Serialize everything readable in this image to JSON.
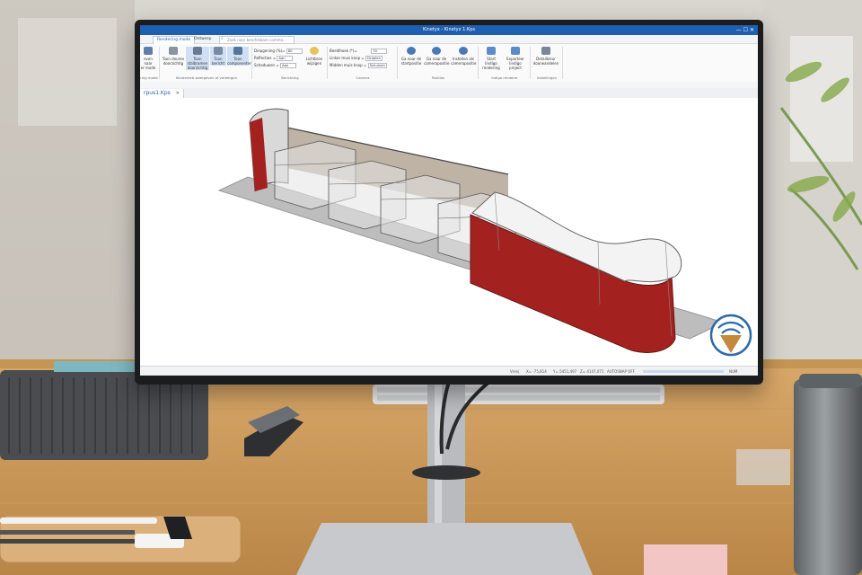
{
  "window": {
    "title": "Kinetyx - Kinetyx 1.Kps",
    "controls": "— ☐ ✕"
  },
  "ribbon_tabs": [
    {
      "label": "Rendering mode",
      "active": true
    },
    {
      "label": "Ontwerp",
      "active": false
    }
  ],
  "search": {
    "placeholder": "Zoek naar beschikbare comma..."
  },
  "ribbon": {
    "left_group": {
      "btn_partial_1": "even naar",
      "btn_partial_2": "er mode",
      "label_partial": "ring mode"
    },
    "view_group": {
      "buttons": [
        {
          "label": "Toon deuren doorzichtig"
        },
        {
          "label": "Toon stalbramen doorzichtig"
        },
        {
          "label": "Toon bericht"
        },
        {
          "label": "Toon componenten"
        }
      ],
      "group_label": "Kenderkeb weergeven of verbergen"
    },
    "render_group": {
      "fields": [
        {
          "label": "Diepgening (%)=",
          "value": "80"
        },
        {
          "label": "Reflecties =",
          "value": "Aan"
        },
        {
          "label": "Schaduwen =",
          "value": "Aan"
        }
      ],
      "button": "Lichtbron wijzigen",
      "group_label": "Berichting"
    },
    "camera_group": {
      "fields": [
        {
          "label": "Beeldhoek (*)=",
          "value": "70"
        },
        {
          "label": "Linker muis knop =",
          "value": "Draaien"
        },
        {
          "label": "Midden muis knop =",
          "value": "Schuiven"
        }
      ],
      "group_label": "Camera"
    },
    "position_group": {
      "buttons": [
        {
          "label": "Ga naar de startpositie"
        },
        {
          "label": "Ga naar de camerapositie"
        },
        {
          "label": "Instellen als camerapositie"
        }
      ],
      "group_label": "Posities"
    },
    "render_start_group": {
      "buttons": [
        {
          "label": "Start lindigo rendering"
        },
        {
          "label": "Exporteer lindigo project"
        }
      ],
      "group_label": "Indigo renderer"
    },
    "settings_group": {
      "buttons": [
        {
          "label": "Detailkleur doorwandelen"
        }
      ],
      "group_label": "Instellingen"
    }
  },
  "document": {
    "tab_label": "rpus1.Kps"
  },
  "statusbar": {
    "mode": "Vrenj",
    "x": "X= -75,814",
    "y": "Y= 5451,497",
    "z": "Z= 4147,071",
    "snap": "AUTOSNAP OFF",
    "num": "NUM"
  },
  "colors": {
    "accent": "#1f5fb0",
    "stand_red": "#a3221f",
    "floor": "#bdbdbd"
  },
  "icons": [
    "logo-badge-icon",
    "stapler-icon",
    "keyboard-icon",
    "plant-icon"
  ]
}
